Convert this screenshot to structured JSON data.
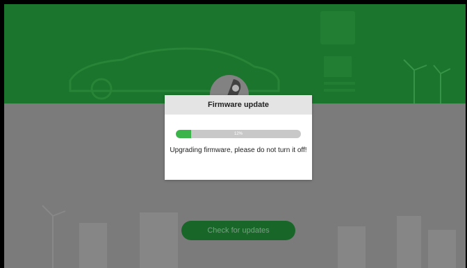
{
  "dialog": {
    "title": "Firmware update",
    "progress_percent": 12,
    "progress_label": "12%",
    "message": "Upgrading firmware, please do not turn it off!"
  },
  "main": {
    "check_button_label": "Check for updates"
  },
  "colors": {
    "hero_green": "#1d7a2e",
    "progress_green": "#3bb54a",
    "button_green": "#1a6b2a"
  },
  "icons": {
    "hero": "rocket-icon"
  }
}
